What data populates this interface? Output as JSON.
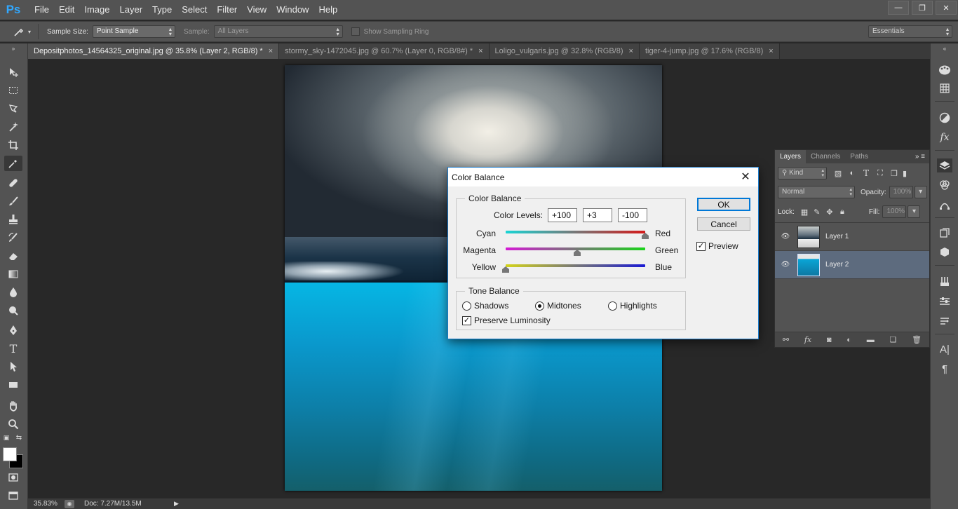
{
  "app": {
    "logo": "Ps"
  },
  "menu": [
    "File",
    "Edit",
    "Image",
    "Layer",
    "Type",
    "Select",
    "Filter",
    "View",
    "Window",
    "Help"
  ],
  "window_controls": {
    "minimize": "—",
    "restore": "❐",
    "close": "✕"
  },
  "options": {
    "sample_size_label": "Sample Size:",
    "sample_size_value": "Point Sample",
    "sample_label": "Sample:",
    "sample_value": "All Layers",
    "show_ring_label": "Show Sampling Ring",
    "workspace": "Essentials"
  },
  "tabs": [
    {
      "label": "Depositphotos_14564325_original.jpg @ 35.8% (Layer 2, RGB/8) *",
      "active": true
    },
    {
      "label": "stormy_sky-1472045.jpg @ 60.7% (Layer 0, RGB/8#) *",
      "active": false
    },
    {
      "label": "Loligo_vulgaris.jpg @ 32.8% (RGB/8)",
      "active": false
    },
    {
      "label": "tiger-4-jump.jpg @ 17.6% (RGB/8)",
      "active": false
    }
  ],
  "status": {
    "zoom": "35.83%",
    "doc": "Doc: 7.27M/13.5M"
  },
  "layers_panel": {
    "tabs": [
      "Layers",
      "Channels",
      "Paths"
    ],
    "kind_label": "Kind",
    "blend_mode": "Normal",
    "opacity_label": "Opacity:",
    "opacity_value": "100%",
    "lock_label": "Lock:",
    "fill_label": "Fill:",
    "fill_value": "100%",
    "layers": [
      {
        "name": "Layer 1",
        "selected": false
      },
      {
        "name": "Layer 2",
        "selected": true
      }
    ]
  },
  "dialog": {
    "title": "Color Balance",
    "group_color": "Color Balance",
    "color_levels_label": "Color Levels:",
    "levels": [
      "+100",
      "+3",
      "-100"
    ],
    "sliders": [
      {
        "left": "Cyan",
        "right": "Red",
        "value": 100
      },
      {
        "left": "Magenta",
        "right": "Green",
        "value": 3
      },
      {
        "left": "Yellow",
        "right": "Blue",
        "value": -100
      }
    ],
    "group_tone": "Tone Balance",
    "tone_options": [
      "Shadows",
      "Midtones",
      "Highlights"
    ],
    "tone_selected": "Midtones",
    "preserve_luminosity": "Preserve Luminosity",
    "ok": "OK",
    "cancel": "Cancel",
    "preview": "Preview"
  }
}
